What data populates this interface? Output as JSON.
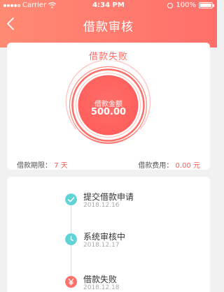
{
  "status_bar": {
    "carrier": "Carrier",
    "time": "4:34 PM",
    "battery": "100%"
  },
  "header": {
    "title": "借款审核"
  },
  "loan": {
    "status": "借款失败",
    "amount_label": "借款金额",
    "amount": "500.00",
    "period_label": "借款期限：",
    "period_value": "7 天",
    "fee_label": "借款费用：",
    "fee_value": "0.00 元"
  },
  "timeline": [
    {
      "name": "提交借款申请",
      "date": "2018.12.16",
      "icon": "check-icon",
      "color": "#5fd3d6"
    },
    {
      "name": "系统审核中",
      "date": "2018.12.17",
      "icon": "clock-icon",
      "color": "#5fd3d6"
    },
    {
      "name": "借款失败",
      "date": "2018.12.18",
      "icon": "yen-icon",
      "color": "#ff6f6a"
    }
  ],
  "colors": {
    "accent": "#ff6f6a",
    "teal": "#5fd3d6"
  }
}
